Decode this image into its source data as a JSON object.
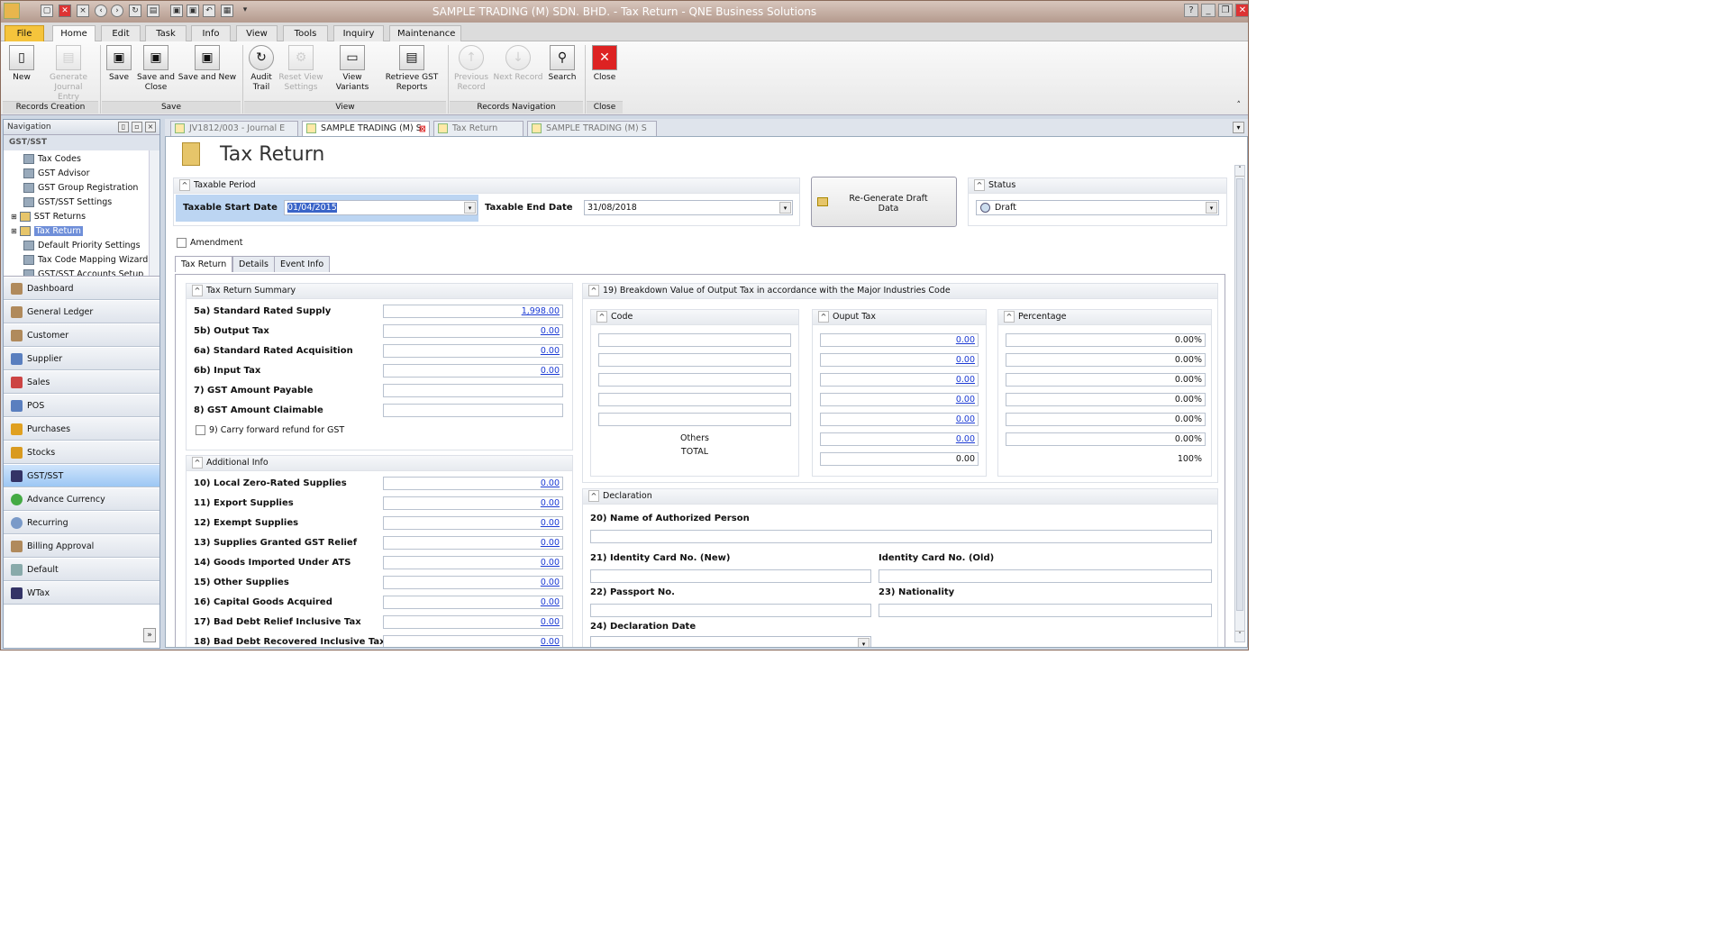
{
  "window": {
    "title": "SAMPLE TRADING (M) SDN. BHD. - Tax Return - QNE Business Solutions"
  },
  "ribbon_tabs": [
    "File",
    "Home",
    "Edit",
    "Task",
    "Info",
    "View",
    "Tools",
    "Inquiry",
    "Maintenance"
  ],
  "ribbon": {
    "new": "New",
    "generate_journal": "Generate Journal Entry",
    "save": "Save",
    "save_close": "Save and Close",
    "save_new": "Save and New",
    "audit_trail": "Audit Trail",
    "reset_view": "Reset View Settings",
    "view_variants": "View Variants",
    "retrieve_gst": "Retrieve GST Reports",
    "previous": "Previous Record",
    "next": "Next Record",
    "search": "Search",
    "close": "Close",
    "groups": {
      "records_creation": "Records Creation",
      "save": "Save",
      "view": "View",
      "records_nav": "Records Navigation",
      "close": "Close"
    }
  },
  "nav": {
    "header": "Navigation",
    "section": "GST/SST",
    "tree": [
      "Tax Codes",
      "GST Advisor",
      "GST Group Registration",
      "GST/SST Settings",
      "SST Returns",
      "Tax Return",
      "Default Priority Settings",
      "Tax Code Mapping Wizard",
      "GST/SST Accounts Setup"
    ],
    "modules": [
      "Dashboard",
      "General Ledger",
      "Customer",
      "Supplier",
      "Sales",
      "POS",
      "Purchases",
      "Stocks",
      "GST/SST",
      "Advance Currency",
      "Recurring",
      "Billing Approval",
      "Default",
      "WTax"
    ]
  },
  "doc_tabs": [
    "JV1812/003 - Journal E",
    "SAMPLE TRADING (M) S",
    "Tax Return",
    "SAMPLE TRADING (M) S"
  ],
  "page": {
    "title": "Tax Return",
    "taxable_period": "Taxable Period",
    "start_label": "Taxable Start Date",
    "start_value": "01/04/2015",
    "end_label": "Taxable End Date",
    "end_value": "31/08/2018",
    "regen": "Re-Generate Draft Data",
    "status_label": "Status",
    "status_value": "Draft",
    "amendment": "Amendment",
    "subtabs": [
      "Tax Return",
      "Details",
      "Event Info"
    ]
  },
  "summary": {
    "title": "Tax Return Summary",
    "rows": [
      {
        "label": "5a) Standard Rated Supply",
        "value": "1,998.00"
      },
      {
        "label": "5b) Output Tax",
        "value": "0.00"
      },
      {
        "label": "6a) Standard Rated Acquisition",
        "value": "0.00"
      },
      {
        "label": "6b) Input Tax",
        "value": "0.00"
      },
      {
        "label": "7) GST Amount Payable",
        "value": ""
      },
      {
        "label": "8) GST Amount Claimable",
        "value": ""
      }
    ],
    "carry_forward": "9) Carry forward refund for GST"
  },
  "additional": {
    "title": "Additional Info",
    "rows": [
      {
        "label": "10) Local Zero-Rated Supplies",
        "value": "0.00"
      },
      {
        "label": "11) Export Supplies",
        "value": "0.00"
      },
      {
        "label": "12) Exempt Supplies",
        "value": "0.00"
      },
      {
        "label": "13) Supplies Granted GST Relief",
        "value": "0.00"
      },
      {
        "label": "14) Goods Imported Under ATS",
        "value": "0.00"
      },
      {
        "label": "15) Other Supplies",
        "value": "0.00"
      },
      {
        "label": "16) Capital Goods Acquired",
        "value": "0.00"
      },
      {
        "label": "17) Bad Debt Relief Inclusive Tax",
        "value": "0.00"
      },
      {
        "label": "18) Bad Debt Recovered Inclusive Tax",
        "value": "0.00"
      }
    ]
  },
  "breakdown": {
    "title": "19) Breakdown Value of Output Tax in accordance with the Major Industries Code",
    "code_title": "Code",
    "output_title": "Ouput Tax",
    "pct_title": "Percentage",
    "output_values": [
      "0.00",
      "0.00",
      "0.00",
      "0.00",
      "0.00",
      "0.00",
      "0.00"
    ],
    "pct_values": [
      "0.00%",
      "0.00%",
      "0.00%",
      "0.00%",
      "0.00%",
      "0.00%"
    ],
    "others": "Others",
    "total": "TOTAL",
    "pct_total": "100%"
  },
  "declaration": {
    "title": "Declaration",
    "name": "20) Name of Authorized Person",
    "ic_new": "21) Identity Card No. (New)",
    "ic_old": "Identity Card No. (Old)",
    "passport": "22) Passport No.",
    "nationality": "23) Nationality",
    "date": "24) Declaration Date"
  }
}
